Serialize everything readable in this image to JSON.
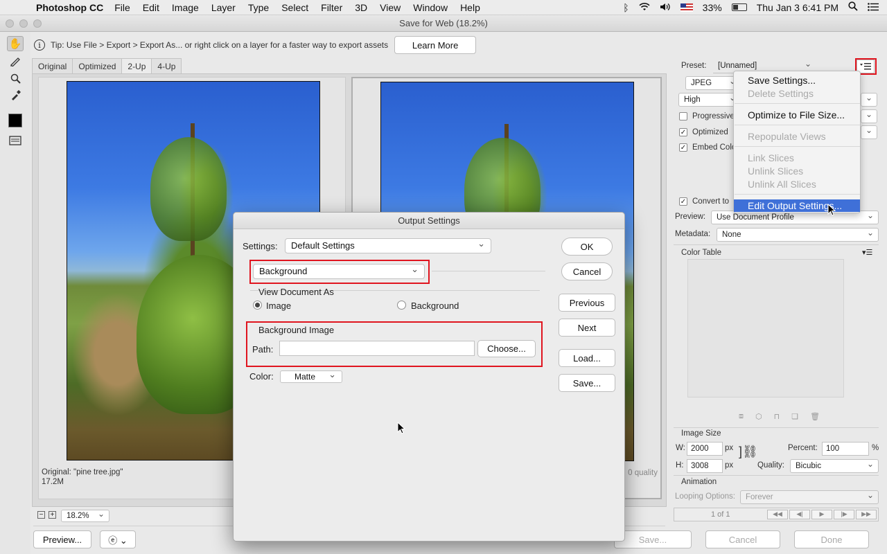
{
  "menubar": {
    "app": "Photoshop CC",
    "items": [
      "File",
      "Edit",
      "Image",
      "Layer",
      "Type",
      "Select",
      "Filter",
      "3D",
      "View",
      "Window",
      "Help"
    ],
    "battery": "33%",
    "clock": "Thu Jan 3  6:41 PM"
  },
  "window": {
    "title": "Save for Web (18.2%)"
  },
  "tip": {
    "text": "Tip: Use File > Export > Export As...  or right click on a layer for a faster way to export assets",
    "learn_more": "Learn More"
  },
  "tabs": [
    "Original",
    "Optimized",
    "2-Up",
    "4-Up"
  ],
  "canvas": {
    "original_caption": "Original: \"pine tree.jpg\"",
    "original_size": "17.2M",
    "optimized_caption_tail": "0 quality"
  },
  "right": {
    "preset_label": "Preset:",
    "preset_value": "[Unnamed]",
    "format_value": "JPEG",
    "quality_level": "High",
    "progressive": "Progressive",
    "optimized": "Optimized",
    "embed": "Embed Colo",
    "convert": "Convert to",
    "preview_label": "Preview:",
    "preview_value": "Use Document Profile",
    "metadata_label": "Metadata:",
    "metadata_value": "None",
    "color_table": "Color Table",
    "image_size": "Image Size",
    "w_label": "W:",
    "w_value": "2000",
    "h_label": "H:",
    "h_value": "3008",
    "px": "px",
    "percent_label": "Percent:",
    "percent_value": "100",
    "percent_sign": "%",
    "quality_label": "Quality:",
    "quality_value": "Bicubic",
    "animation": "Animation",
    "looping_label": "Looping Options:",
    "looping_value": "Forever",
    "frame_counter": "1 of 1"
  },
  "flyout": {
    "items": [
      {
        "label": "Save Settings...",
        "state": "enabled"
      },
      {
        "label": "Delete Settings",
        "state": "disabled"
      },
      {
        "label": "Optimize to File Size...",
        "state": "enabled"
      },
      {
        "label": "Repopulate Views",
        "state": "disabled"
      },
      {
        "label": "Link Slices",
        "state": "disabled"
      },
      {
        "label": "Unlink Slices",
        "state": "disabled"
      },
      {
        "label": "Unlink All Slices",
        "state": "disabled"
      },
      {
        "label": "Edit Output Settings...",
        "state": "highlighted"
      }
    ]
  },
  "bottom": {
    "zoom": "18.2%",
    "preview": "Preview...",
    "save": "Save...",
    "cancel": "Cancel",
    "done": "Done"
  },
  "dialog": {
    "title": "Output Settings",
    "settings_label": "Settings:",
    "settings_value": "Default Settings",
    "category_value": "Background",
    "view_as": "View Document As",
    "radio_image": "Image",
    "radio_background": "Background",
    "bg_image_group": "Background Image",
    "path_label": "Path:",
    "path_value": "",
    "choose": "Choose...",
    "color_label": "Color:",
    "color_value": "Matte",
    "ok": "OK",
    "cancel": "Cancel",
    "previous": "Previous",
    "next": "Next",
    "load": "Load...",
    "save": "Save..."
  },
  "colors": {
    "accent_red": "#e0141e",
    "menu_highlight": "#3f70d8"
  }
}
